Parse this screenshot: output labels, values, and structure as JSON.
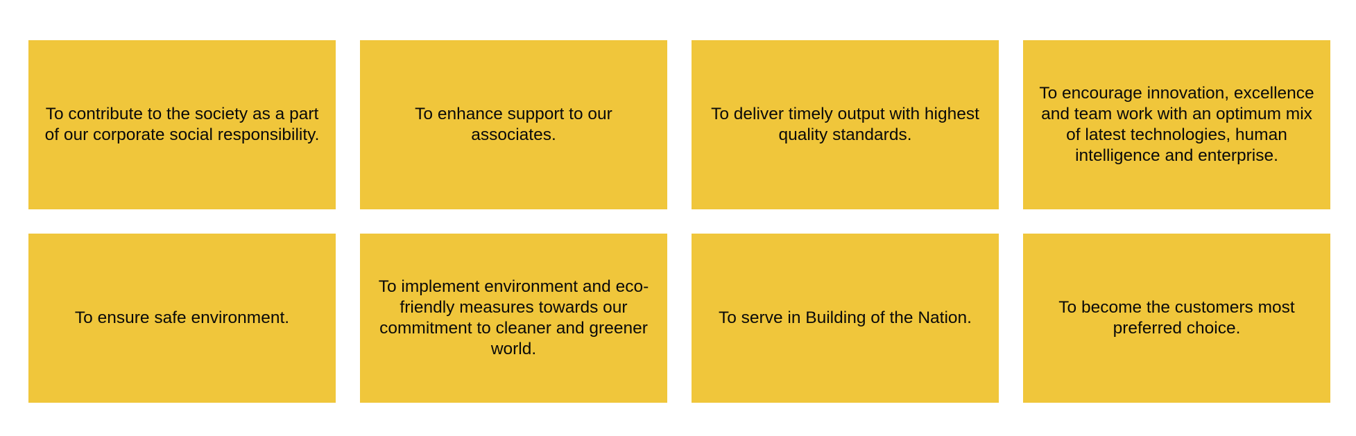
{
  "colors": {
    "card_background": "#f0c63b",
    "text": "#0a0a0a",
    "page_background": "#ffffff"
  },
  "cards": [
    {
      "text": "To contribute to the society as a part of our corporate social responsibility."
    },
    {
      "text": "To enhance support to our associates."
    },
    {
      "text": "To deliver timely output with highest quality standards."
    },
    {
      "text": "To encourage innovation, excellence and team work with an optimum mix of latest technologies, human intelligence and enterprise."
    },
    {
      "text": "To ensure safe environment."
    },
    {
      "text": "To implement environment and eco-friendly measures towards our commitment to cleaner and greener world."
    },
    {
      "text": "To serve in Building of the Nation."
    },
    {
      "text": "To become the customers most preferred choice."
    }
  ]
}
